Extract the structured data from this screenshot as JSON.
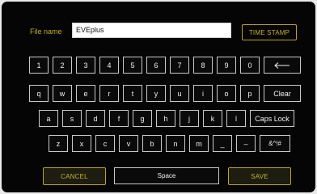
{
  "filename": {
    "label": "File name",
    "value": "EVEplus"
  },
  "timestamp_label": "TIME STAMP",
  "keyboard": {
    "row1": [
      "1",
      "2",
      "3",
      "4",
      "5",
      "6",
      "7",
      "8",
      "9",
      "0"
    ],
    "row2": [
      "q",
      "w",
      "e",
      "r",
      "t",
      "y",
      "u",
      "i",
      "o",
      "p"
    ],
    "row2_clear": "Clear",
    "row3": [
      "a",
      "s",
      "d",
      "f",
      "g",
      "h",
      "j",
      "k",
      "l"
    ],
    "row3_capslock": "Caps Lock",
    "row4": [
      "z",
      "x",
      "c",
      "v",
      "b",
      "n",
      "m",
      "_",
      "–"
    ],
    "row4_symbols": "&^!#"
  },
  "actions": {
    "cancel": "CANCEL",
    "space": "Space",
    "save": "SAVE"
  },
  "colors": {
    "accent": "#c4ae2f",
    "panel": "#050505",
    "key_border": "#c9c9c9"
  },
  "icons": {
    "backspace": "backspace-arrow-icon"
  }
}
